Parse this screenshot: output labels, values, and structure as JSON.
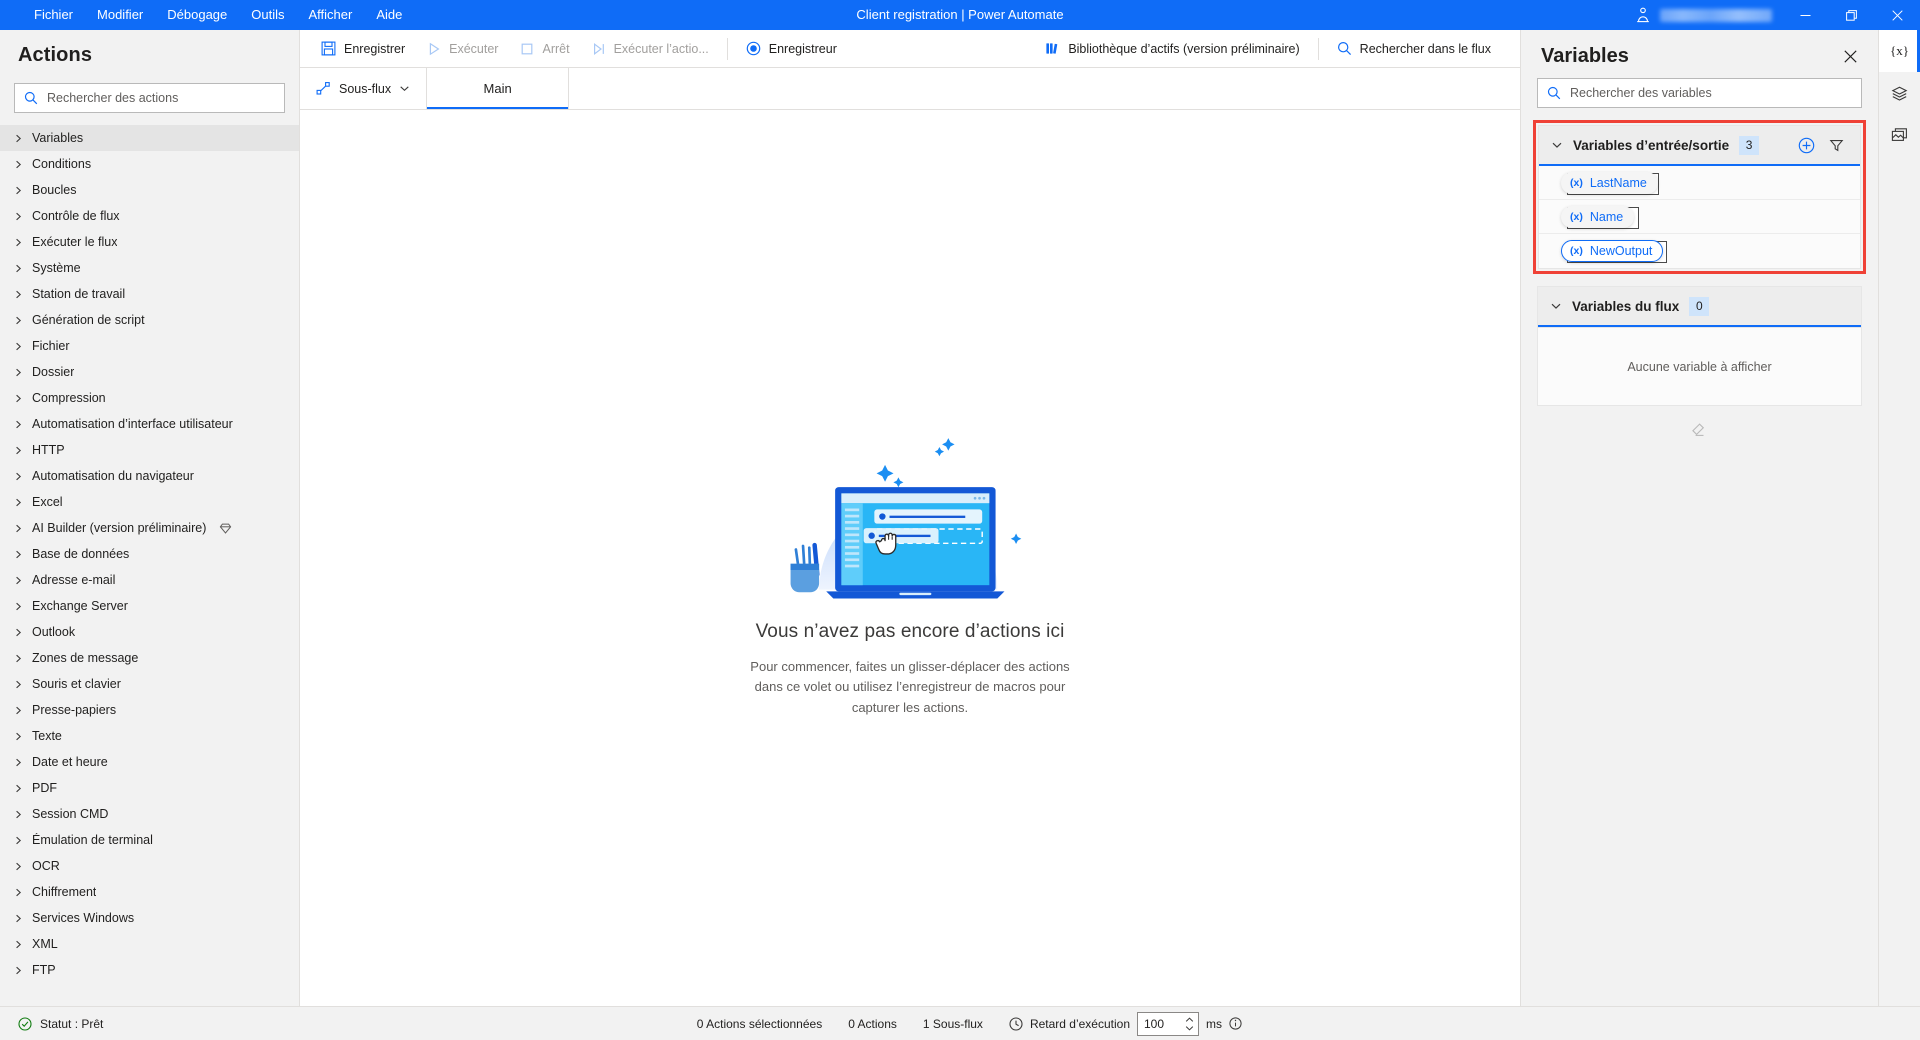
{
  "titlebar": {
    "menu": [
      {
        "label": "Fichier"
      },
      {
        "label": "Modifier"
      },
      {
        "label": "Débogage"
      },
      {
        "label": "Outils"
      },
      {
        "label": "Afficher"
      },
      {
        "label": "Aide"
      }
    ],
    "app_title": "Client registration | Power Automate",
    "account_icon": "account-shield-icon",
    "minimize_label": "—",
    "restore_label": "Restaurer",
    "close_label": "Fermer",
    "accent_color": "#0f6cf7"
  },
  "actions_panel": {
    "title": "Actions",
    "search": {
      "placeholder": "Rechercher des actions",
      "value": "",
      "icon": "search-icon"
    },
    "items": [
      {
        "label": "Variables",
        "selected": true,
        "premium": false
      },
      {
        "label": "Conditions",
        "selected": false,
        "premium": false
      },
      {
        "label": "Boucles",
        "selected": false,
        "premium": false
      },
      {
        "label": "Contrôle de flux",
        "selected": false,
        "premium": false
      },
      {
        "label": "Exécuter le flux",
        "selected": false,
        "premium": false
      },
      {
        "label": "Système",
        "selected": false,
        "premium": false
      },
      {
        "label": "Station de travail",
        "selected": false,
        "premium": false
      },
      {
        "label": "Génération de script",
        "selected": false,
        "premium": false
      },
      {
        "label": "Fichier",
        "selected": false,
        "premium": false
      },
      {
        "label": "Dossier",
        "selected": false,
        "premium": false
      },
      {
        "label": "Compression",
        "selected": false,
        "premium": false
      },
      {
        "label": "Automatisation d’interface utilisateur",
        "selected": false,
        "premium": false
      },
      {
        "label": "HTTP",
        "selected": false,
        "premium": false
      },
      {
        "label": "Automatisation du navigateur",
        "selected": false,
        "premium": false
      },
      {
        "label": "Excel",
        "selected": false,
        "premium": false
      },
      {
        "label": "AI Builder (version préliminaire)",
        "selected": false,
        "premium": true
      },
      {
        "label": "Base de données",
        "selected": false,
        "premium": false
      },
      {
        "label": "Adresse e-mail",
        "selected": false,
        "premium": false
      },
      {
        "label": "Exchange Server",
        "selected": false,
        "premium": false
      },
      {
        "label": "Outlook",
        "selected": false,
        "premium": false
      },
      {
        "label": "Zones de message",
        "selected": false,
        "premium": false
      },
      {
        "label": "Souris et clavier",
        "selected": false,
        "premium": false
      },
      {
        "label": "Presse-papiers",
        "selected": false,
        "premium": false
      },
      {
        "label": "Texte",
        "selected": false,
        "premium": false
      },
      {
        "label": "Date et heure",
        "selected": false,
        "premium": false
      },
      {
        "label": "PDF",
        "selected": false,
        "premium": false
      },
      {
        "label": "Session CMD",
        "selected": false,
        "premium": false
      },
      {
        "label": "Émulation de terminal",
        "selected": false,
        "premium": false
      },
      {
        "label": "OCR",
        "selected": false,
        "premium": false
      },
      {
        "label": "Chiffrement",
        "selected": false,
        "premium": false
      },
      {
        "label": "Services Windows",
        "selected": false,
        "premium": false
      },
      {
        "label": "XML",
        "selected": false,
        "premium": false
      },
      {
        "label": "FTP",
        "selected": false,
        "premium": false
      }
    ]
  },
  "toolbar": {
    "save": {
      "label": "Enregistrer",
      "icon": "save-icon",
      "disabled": false
    },
    "run": {
      "label": "Exécuter",
      "icon": "play-icon",
      "disabled": true
    },
    "stop": {
      "label": "Arrêt",
      "icon": "stop-icon",
      "disabled": true
    },
    "run_action": {
      "label": "Exécuter l’actio...",
      "icon": "step-icon",
      "disabled": true
    },
    "recorder": {
      "label": "Enregistreur",
      "icon": "record-icon",
      "disabled": false
    },
    "asset_library": {
      "label": "Bibliothèque d’actifs (version préliminaire)",
      "icon": "library-icon",
      "disabled": false
    },
    "search_flow": {
      "label": "Rechercher dans le flux",
      "icon": "search-icon",
      "disabled": false
    }
  },
  "tabs": {
    "subflow": {
      "label": "Sous-flux",
      "icon": "subflow-icon",
      "chevron": "chevron-down-icon"
    },
    "flow_tabs": [
      {
        "label": "Main",
        "active": true
      }
    ]
  },
  "canvas": {
    "empty_title": "Vous n’avez pas encore d’actions ici",
    "empty_subtitle": "Pour commencer, faites un glisser-déplacer des actions dans ce volet ou utilisez l’enregistreur de macros pour capturer les actions.",
    "illustration": "laptop-drag-drop-illustration"
  },
  "variables_pane": {
    "title": "Variables",
    "close_icon": "close-icon",
    "search": {
      "placeholder": "Rechercher des variables",
      "value": "",
      "icon": "search-icon"
    },
    "highlight_color": "#ef4136",
    "io_section": {
      "name": "Variables d’entrée/sortie",
      "count": "3",
      "chevron": "chevron-down-icon",
      "add_icon": "add-circle-icon",
      "filter_icon": "filter-icon",
      "variables": [
        {
          "name": "LastName",
          "prefix": "(x)",
          "focused": false
        },
        {
          "name": "Name",
          "prefix": "(x)",
          "focused": false
        },
        {
          "name": "NewOutput",
          "prefix": "(x)",
          "focused": true
        }
      ]
    },
    "flow_section": {
      "name": "Variables du flux",
      "count": "0",
      "chevron": "chevron-down-icon",
      "empty_text": "Aucune variable à afficher"
    },
    "footer_icon": "eraser-icon"
  },
  "rail": [
    {
      "icon": "variables-x-icon",
      "label": "{x}",
      "active": true
    },
    {
      "icon": "ui-elements-layers-icon",
      "label": "",
      "active": false
    },
    {
      "icon": "images-icon",
      "label": "",
      "active": false
    }
  ],
  "statusbar": {
    "status_icon": "check-circle-icon",
    "status_text": "Statut : Prêt",
    "selected_actions": "0 Actions sélectionnées",
    "actions_count": "0 Actions",
    "subflows_count": "1 Sous-flux",
    "delay_icon": "clock-icon",
    "delay_label": "Retard d’exécution",
    "delay_value": "100",
    "delay_unit": "ms",
    "info_icon": "info-icon"
  }
}
